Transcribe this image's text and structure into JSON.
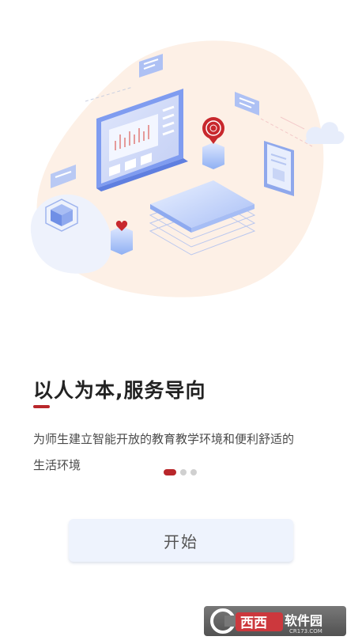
{
  "slide": {
    "title": "以人为本,服务导向",
    "description_line1": "为师生建立智能开放的教育教学环境和便利舒适的",
    "description_line2": "生活环境"
  },
  "pager": {
    "total": 3,
    "active_index": 0
  },
  "start_button": {
    "label": "开始"
  },
  "watermark": {
    "brand": "西西软件园",
    "domain": "CR173.COM"
  },
  "colors": {
    "accent": "#b9272b",
    "button_bg": "#eef3fd",
    "blob": "#fdf0e6",
    "illustration_blue": "#7f9cf0"
  },
  "icons": [
    "isometric-classroom-illustration",
    "cloud-icon",
    "heart-icon",
    "badge-icon"
  ]
}
